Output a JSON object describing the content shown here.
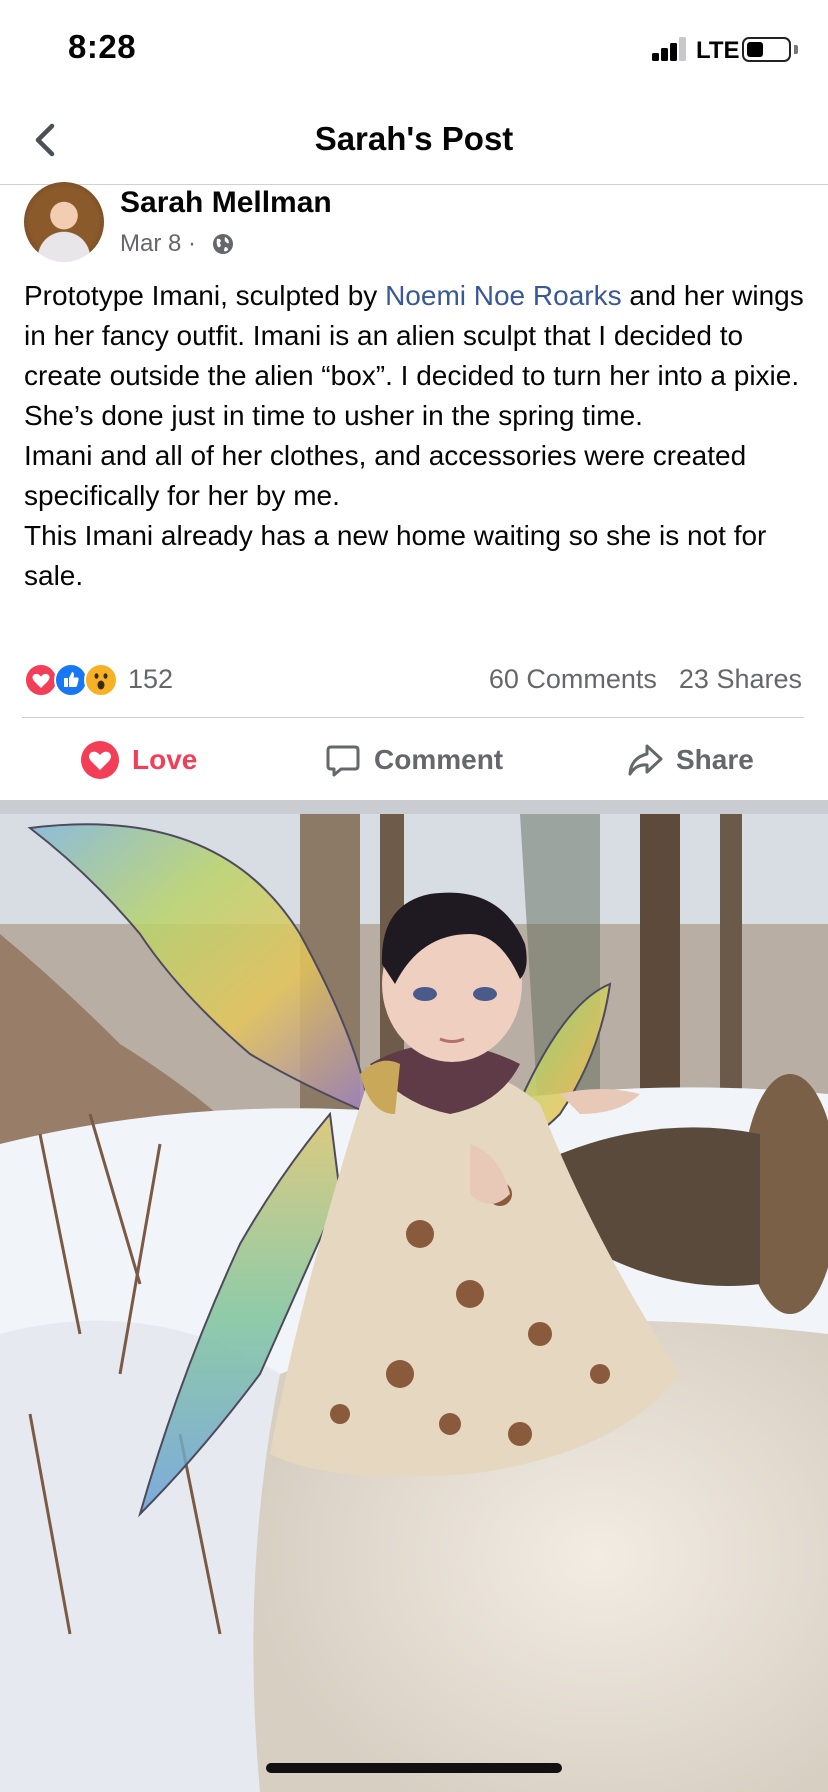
{
  "status_bar": {
    "time": "8:28",
    "network": "LTE"
  },
  "header": {
    "title": "Sarah's Post",
    "back_icon": "chevron-left-icon"
  },
  "post": {
    "author": "Sarah Mellman",
    "date": "Mar 8",
    "meta_separator": " · ",
    "privacy_icon": "globe-icon",
    "text_part1": "Prototype Imani, sculpted by ",
    "mention": "Noemi Noe Roarks",
    "text_part2": " and her wings in her fancy outfit. Imani is an alien sculpt that I decided to create outside the alien “box”. I decided to turn her into a pixie. She’s done just in time to usher in the spring time.",
    "paragraph2": "Imani and all of her clothes, and accessories were created specifically for her by me.",
    "paragraph3": "This Imani already has a new home waiting so she is not for sale."
  },
  "engagement": {
    "reaction_count": "152",
    "comments": "60 Comments",
    "shares": "23 Shares",
    "reactions": [
      "love",
      "like",
      "wow"
    ]
  },
  "actions": {
    "love_label": "Love",
    "comment_label": "Comment",
    "share_label": "Share"
  },
  "colors": {
    "love": "#f33e58",
    "like": "#1877f2",
    "wow": "#f7b125",
    "mention": "#385898",
    "secondary_text": "#65676b"
  },
  "photo": {
    "subject": "doll-photo"
  }
}
